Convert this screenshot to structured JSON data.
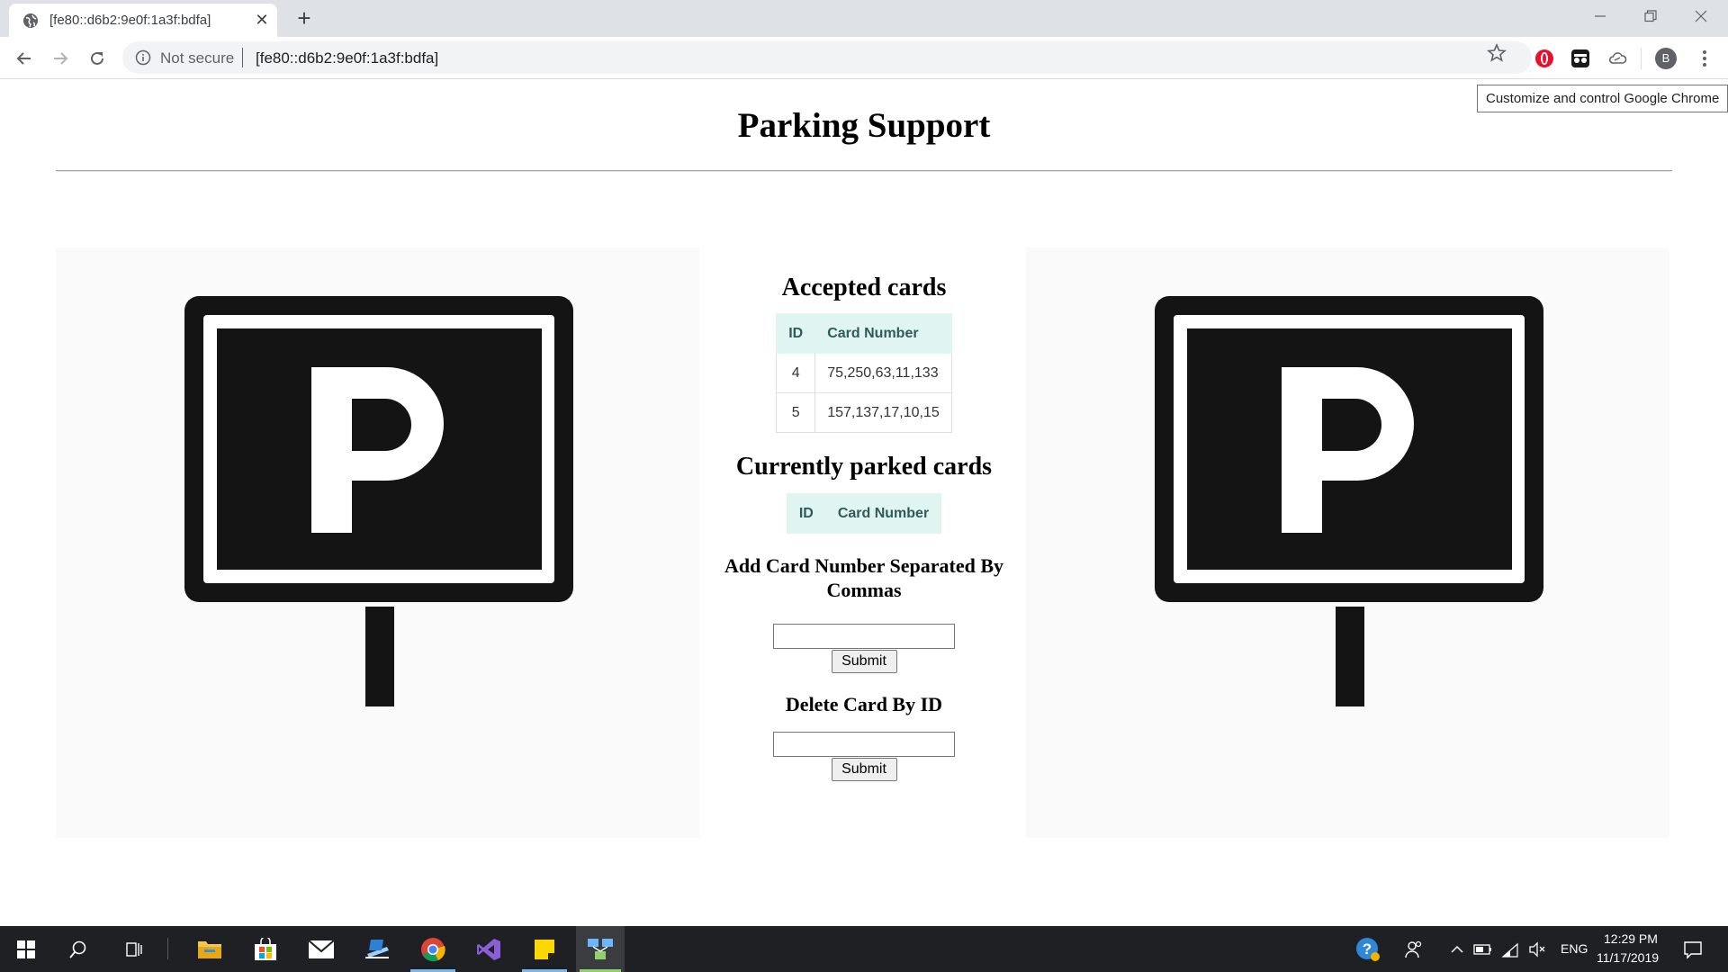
{
  "browser": {
    "tab_title": "[fe80::d6b2:9e0f:1a3f:bdfa]",
    "tab_close": "✕",
    "new_tab": "+",
    "security_label": "Not secure",
    "url": "[fe80::d6b2:9e0f:1a3f:bdfa]",
    "profile_initial": "B",
    "menu_tooltip": "Customize and control Google Chrome"
  },
  "page": {
    "title": "Parking Support",
    "accepted": {
      "heading": "Accepted cards",
      "columns": [
        "ID",
        "Card Number"
      ],
      "rows": [
        {
          "id": "4",
          "card": "75,250,63,11,133"
        },
        {
          "id": "5",
          "card": "157,137,17,10,15"
        }
      ]
    },
    "parked": {
      "heading": "Currently parked cards",
      "columns": [
        "ID",
        "Card Number"
      ]
    },
    "add_form": {
      "heading": "Add Card Number Separated By Commas",
      "value": "",
      "submit": "Submit"
    },
    "delete_form": {
      "heading": "Delete Card By ID",
      "value": "",
      "submit": "Submit"
    },
    "sign_letter": "P"
  },
  "taskbar": {
    "time": "12:29 PM",
    "date": "11/17/2019",
    "language": "ENG"
  },
  "colors": {
    "table_header_bg": "#e0f4f2",
    "table_header_text": "#2f5b59",
    "sign": "#141414",
    "taskbar": "#1f2024"
  }
}
